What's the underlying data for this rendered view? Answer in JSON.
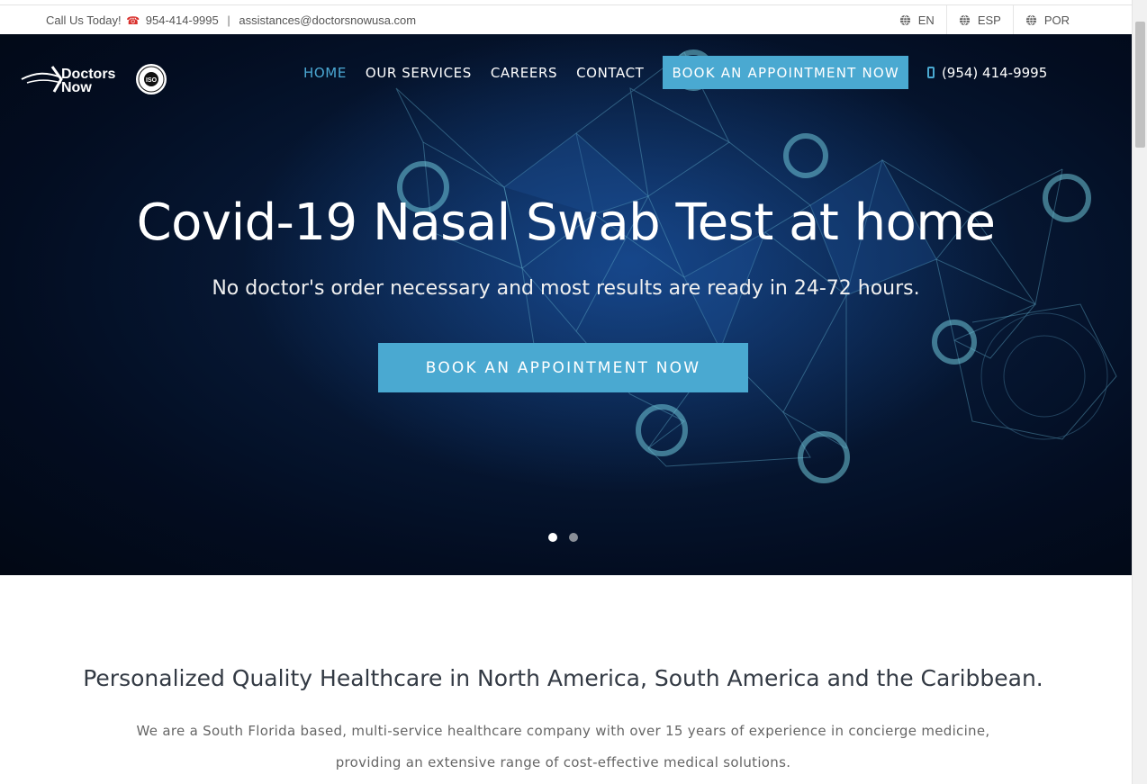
{
  "topbar": {
    "call_label": "Call Us Today!",
    "phone": "954-414-9995",
    "separator": "|",
    "email": "assistances@doctorsnowusa.com",
    "languages": [
      "EN",
      "ESP",
      "POR"
    ]
  },
  "brand": {
    "logo_text_1": "Doctors",
    "logo_text_2": "Now",
    "badge_text": "ISO"
  },
  "nav": {
    "items": [
      "HOME",
      "OUR SERVICES",
      "CAREERS",
      "CONTACT"
    ],
    "cta": "BOOK AN APPOINTMENT NOW",
    "phone": "(954) 414-9995"
  },
  "hero": {
    "title": "Covid-19 Nasal Swab Test at home",
    "subtitle": "No doctor's order necessary and most results are ready in 24-72 hours.",
    "button": "BOOK AN APPOINTMENT NOW",
    "slides_total": 2,
    "active_slide": 1
  },
  "intro": {
    "title": "Personalized Quality Healthcare in North America, South America and the Caribbean.",
    "line_1": "We are a South Florida based, multi-service healthcare company with over 15 years of experience in concierge medicine,",
    "line_2": "providing an extensive range of cost-effective medical solutions."
  },
  "colors": {
    "accent": "#4aa9d1",
    "nav_active": "#4ba8d3",
    "hero_bg": "#030d21"
  }
}
